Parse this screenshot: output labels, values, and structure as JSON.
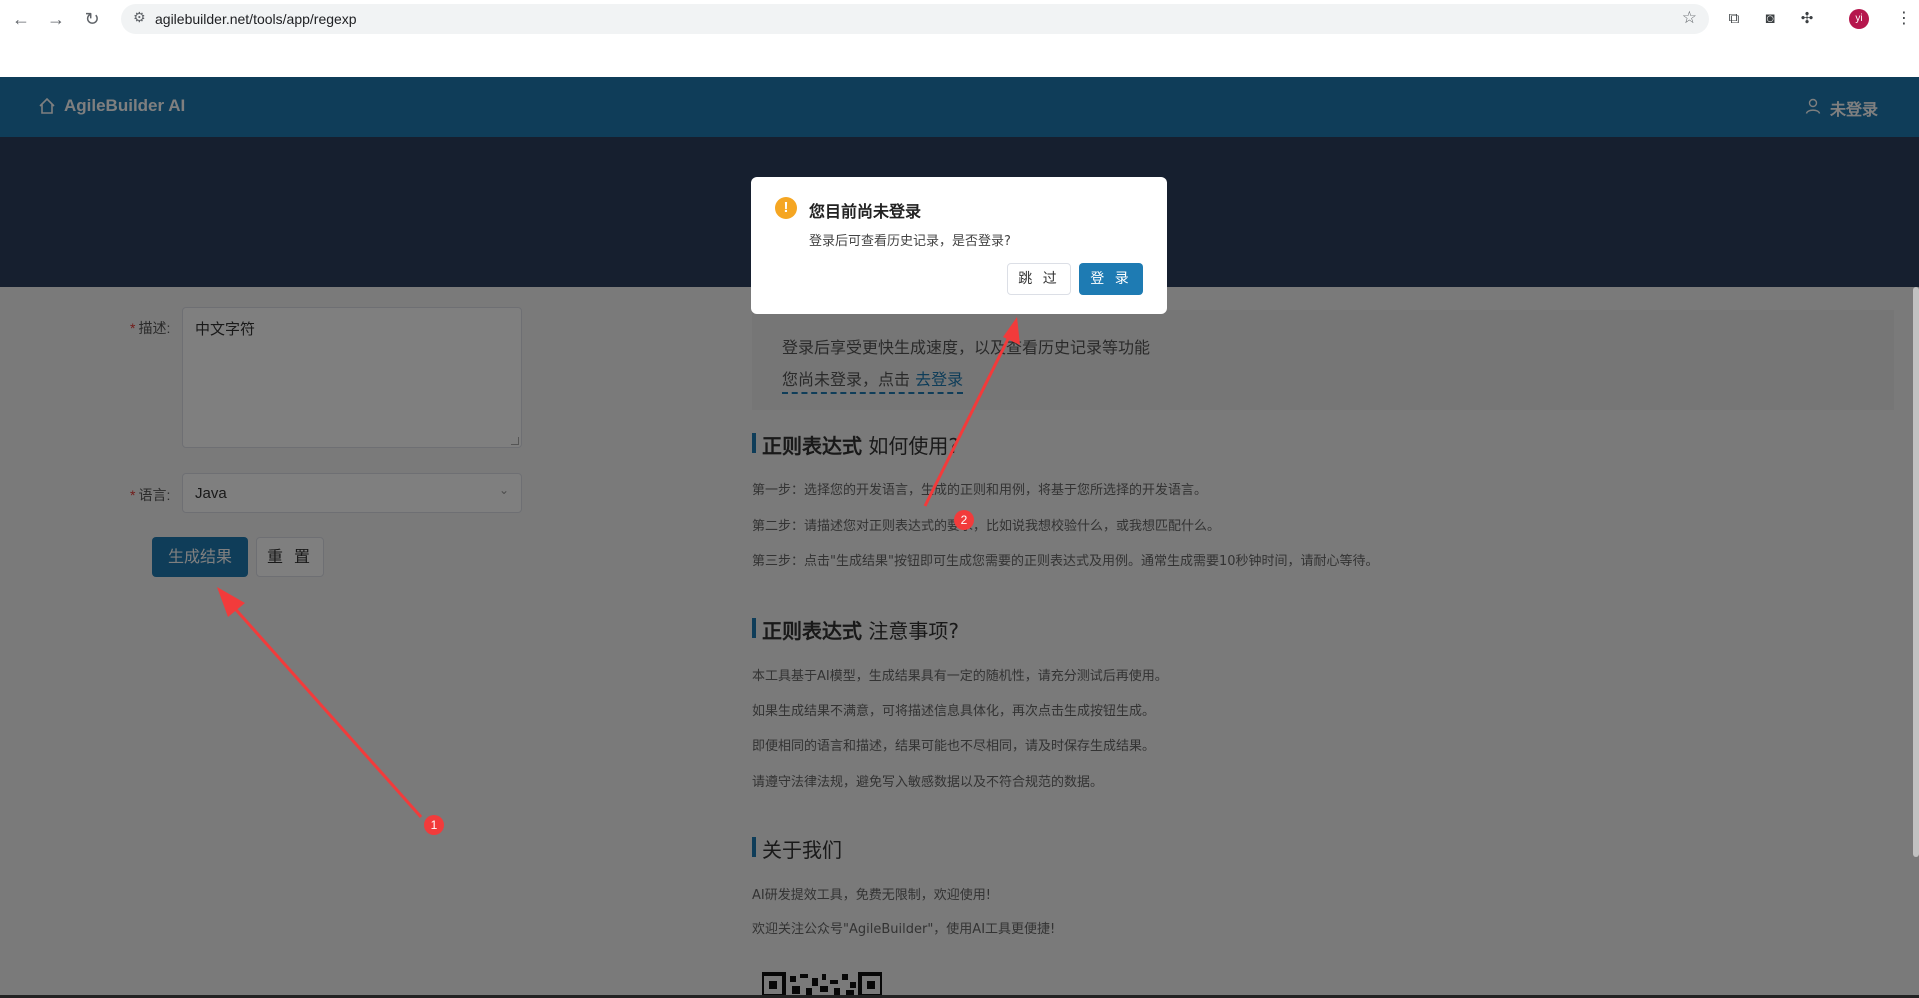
{
  "browser": {
    "url": "agilebuilder.net/tools/app/regexp",
    "avatar_initials": "yi"
  },
  "header": {
    "brand": "AgileBuilder AI",
    "login_status": "未登录"
  },
  "form": {
    "desc_label": "描述:",
    "desc_value": "中文字符",
    "lang_label": "语言:",
    "lang_value": "Java",
    "generate_label": "生成结果",
    "reset_label": "重 置"
  },
  "notice": {
    "line1": "登录后享受更快生成速度，以及查看历史记录等功能",
    "line2_prefix": "您尚未登录，点击",
    "line2_link": "去登录"
  },
  "usage": {
    "title_bold": "正则表达式",
    "title_rest": " 如何使用?",
    "steps": [
      "第一步：选择您的开发语言，生成的正则和用例，将基于您所选择的开发语言。",
      "第二步：请描述您对正则表达式的要求，比如说我想校验什么，或我想匹配什么。",
      "第三步：点击\"生成结果\"按钮即可生成您需要的正则表达式及用例。通常生成需要10秒钟时间，请耐心等待。"
    ]
  },
  "notes": {
    "title_bold": "正则表达式",
    "title_rest": " 注意事项?",
    "items": [
      "本工具基于AI模型，生成结果具有一定的随机性，请充分测试后再使用。",
      "如果生成结果不满意，可将描述信息具体化，再次点击生成按钮生成。",
      "即便相同的语言和描述，结果可能也不尽相同，请及时保存生成结果。",
      "请遵守法律法规，避免写入敏感数据以及不符合规范的数据。"
    ]
  },
  "about": {
    "title": "关于我们",
    "items": [
      "AI研发提效工具，免费无限制，欢迎使用!",
      "欢迎关注公众号\"AgileBuilder\"，使用AI工具更便捷!"
    ]
  },
  "dialog": {
    "title": "您目前尚未登录",
    "message": "登录后可查看历史记录，是否登录?",
    "skip_label": "跳 过",
    "login_label": "登 录",
    "warn_glyph": "!"
  },
  "annotations": {
    "badge1": "1",
    "badge2": "2",
    "color": "#f23b3b"
  }
}
